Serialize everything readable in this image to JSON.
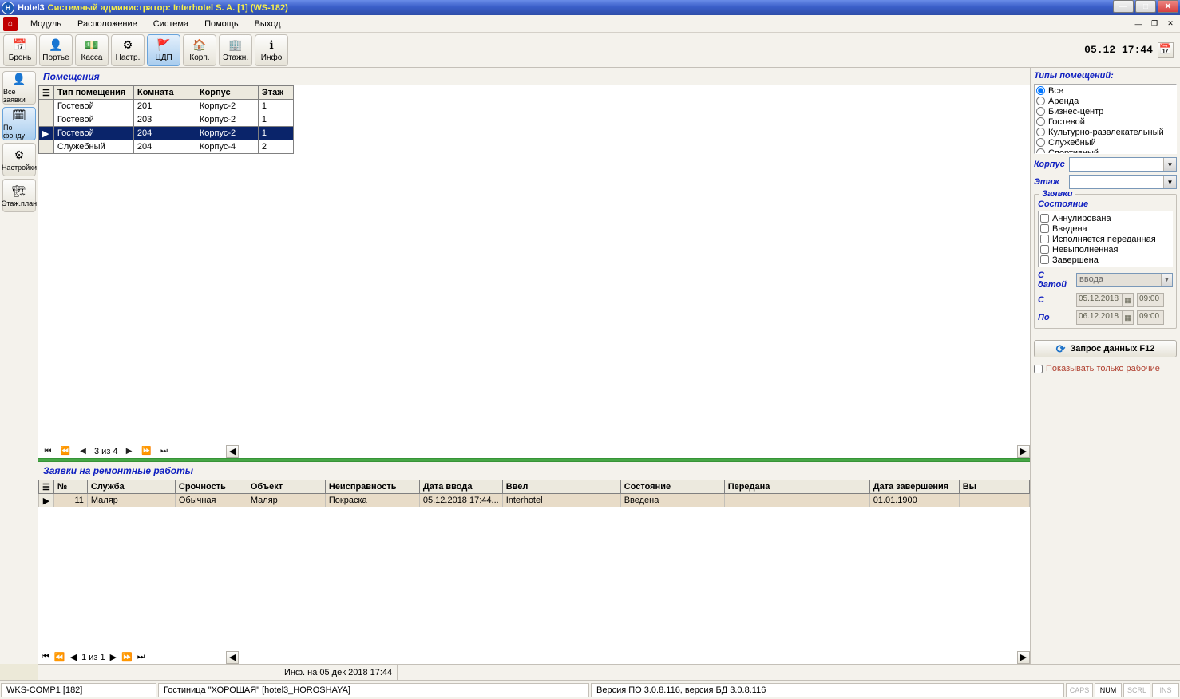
{
  "title": {
    "app": "Hotel3",
    "sub": "Системный администратор: Interhotel S. A. [1] (WS-182)"
  },
  "menu": {
    "module": "Модуль",
    "layout": "Расположение",
    "system": "Система",
    "help": "Помощь",
    "exit": "Выход"
  },
  "toolbar": {
    "bron": "Бронь",
    "porter": "Портье",
    "kassa": "Касса",
    "nastr": "Настр.",
    "cdp": "ЦДП",
    "korp": "Корп.",
    "etazhn": "Этажн.",
    "info": "Инфо",
    "datetime": "05.12 17:44"
  },
  "left_tools": {
    "all_req": "Все заявки",
    "by_fund": "По фонду",
    "settings": "Настройки",
    "floor_plan": "Этаж.план"
  },
  "rooms": {
    "title": "Помещения",
    "columns": {
      "type": "Тип помещения",
      "room": "Комната",
      "korpus": "Корпус",
      "floor": "Этаж"
    },
    "rows": [
      {
        "type": "Гостевой",
        "room": "201",
        "korpus": "Корпус-2",
        "floor": "1",
        "selected": false
      },
      {
        "type": "Гостевой",
        "room": "203",
        "korpus": "Корпус-2",
        "floor": "1",
        "selected": false
      },
      {
        "type": "Гостевой",
        "room": "204",
        "korpus": "Корпус-2",
        "floor": "1",
        "selected": true
      },
      {
        "type": "Служебный",
        "room": "204",
        "korpus": "Корпус-4",
        "floor": "2",
        "selected": false
      }
    ],
    "nav_pos": "3 из 4"
  },
  "requests": {
    "title": "Заявки на ремонтные работы",
    "columns": {
      "num": "№",
      "service": "Служба",
      "urgency": "Срочность",
      "object": "Объект",
      "fault": "Неисправность",
      "entered": "Дата ввода",
      "by": "Ввел",
      "state": "Состояние",
      "passed": "Передана",
      "completed": "Дата завершения",
      "extra": "Вы"
    },
    "rows": [
      {
        "num": "11",
        "service": "Маляр",
        "urgency": "Обычная",
        "object": "Маляр",
        "fault": "Покраска",
        "entered": "05.12.2018 17:44...",
        "by": "Interhotel",
        "state": "Введена",
        "passed": "",
        "completed": "01.01.1900"
      }
    ],
    "nav_pos": "1 из 1"
  },
  "filter": {
    "types_title": "Типы помещений:",
    "types": [
      "Все",
      "Аренда",
      "Бизнес-центр",
      "Гостевой",
      "Культурно-развлекательный",
      "Служебный",
      "Спортивный"
    ],
    "types_selected": 0,
    "korpus_label": "Корпус",
    "floor_label": "Этаж",
    "requests_group": "Заявки",
    "state_sub": "Состояние",
    "states": [
      "Аннулирована",
      "Введена",
      "Исполняется переданная",
      "Невыполненная",
      "Завершена"
    ],
    "withdate_label": "С датой",
    "withdate_value": "ввода",
    "from_label": "С",
    "to_label": "По",
    "date_from": "05.12.2018",
    "time_from": "09:00",
    "date_to": "06.12.2018",
    "time_to": "09:00",
    "query_btn": "Запрос данных F12",
    "show_only_label": "Показывать только рабочие"
  },
  "infobar": {
    "text": "Инф. на 05 дек 2018 17:44"
  },
  "statusbar": {
    "ws": "WKS-COMP1 [182]",
    "hotel": "Гостиница \"ХОРОШАЯ\" [hotel3_HOROSHAYA]",
    "version": "Версия ПО 3.0.8.116, версия БД 3.0.8.116",
    "caps": "CAPS",
    "num": "NUM",
    "scrl": "SCRL",
    "ins": "INS"
  }
}
